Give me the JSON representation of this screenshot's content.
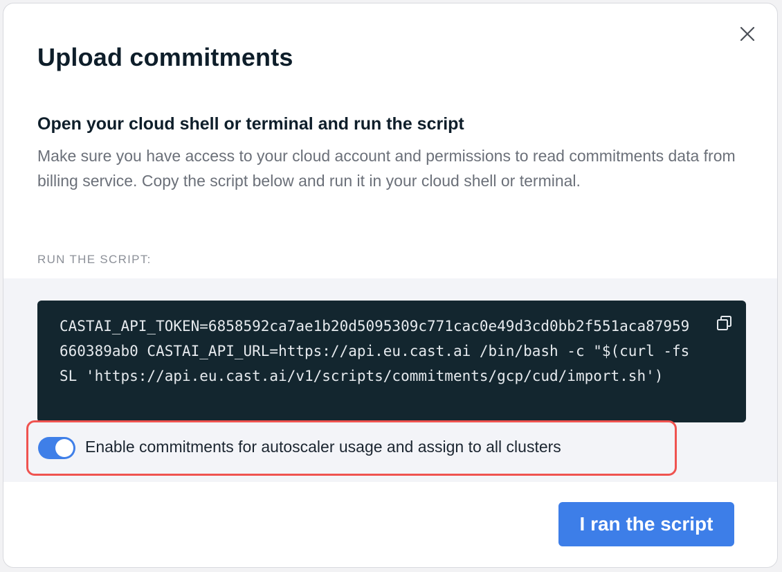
{
  "modal": {
    "title": "Upload commitments",
    "subheading": "Open your cloud shell or terminal and run the script",
    "description": "Make sure you have access to your cloud account and permissions to read commitments data from billing service. Copy the script below and run it in your cloud shell or terminal.",
    "section_label": "RUN THE SCRIPT:",
    "script": "CASTAI_API_TOKEN=6858592ca7ae1b20d5095309c771cac0e49d3cd0bb2f551aca87959660389ab0 CASTAI_API_URL=https://api.eu.cast.ai /bin/bash -c \"$(curl -fsSL 'https://api.eu.cast.ai/v1/scripts/commitments/gcp/cud/import.sh')",
    "toggle": {
      "label": "Enable commitments for autoscaler usage and assign to all clusters",
      "checked": true
    },
    "primary_button": "I ran the script"
  },
  "icons": {
    "close": "close-icon",
    "copy": "copy-icon"
  },
  "colors": {
    "accent": "#3d7ee8",
    "code_background": "#13262f",
    "highlight_border": "#ef5350",
    "band": "#f3f4f8"
  }
}
